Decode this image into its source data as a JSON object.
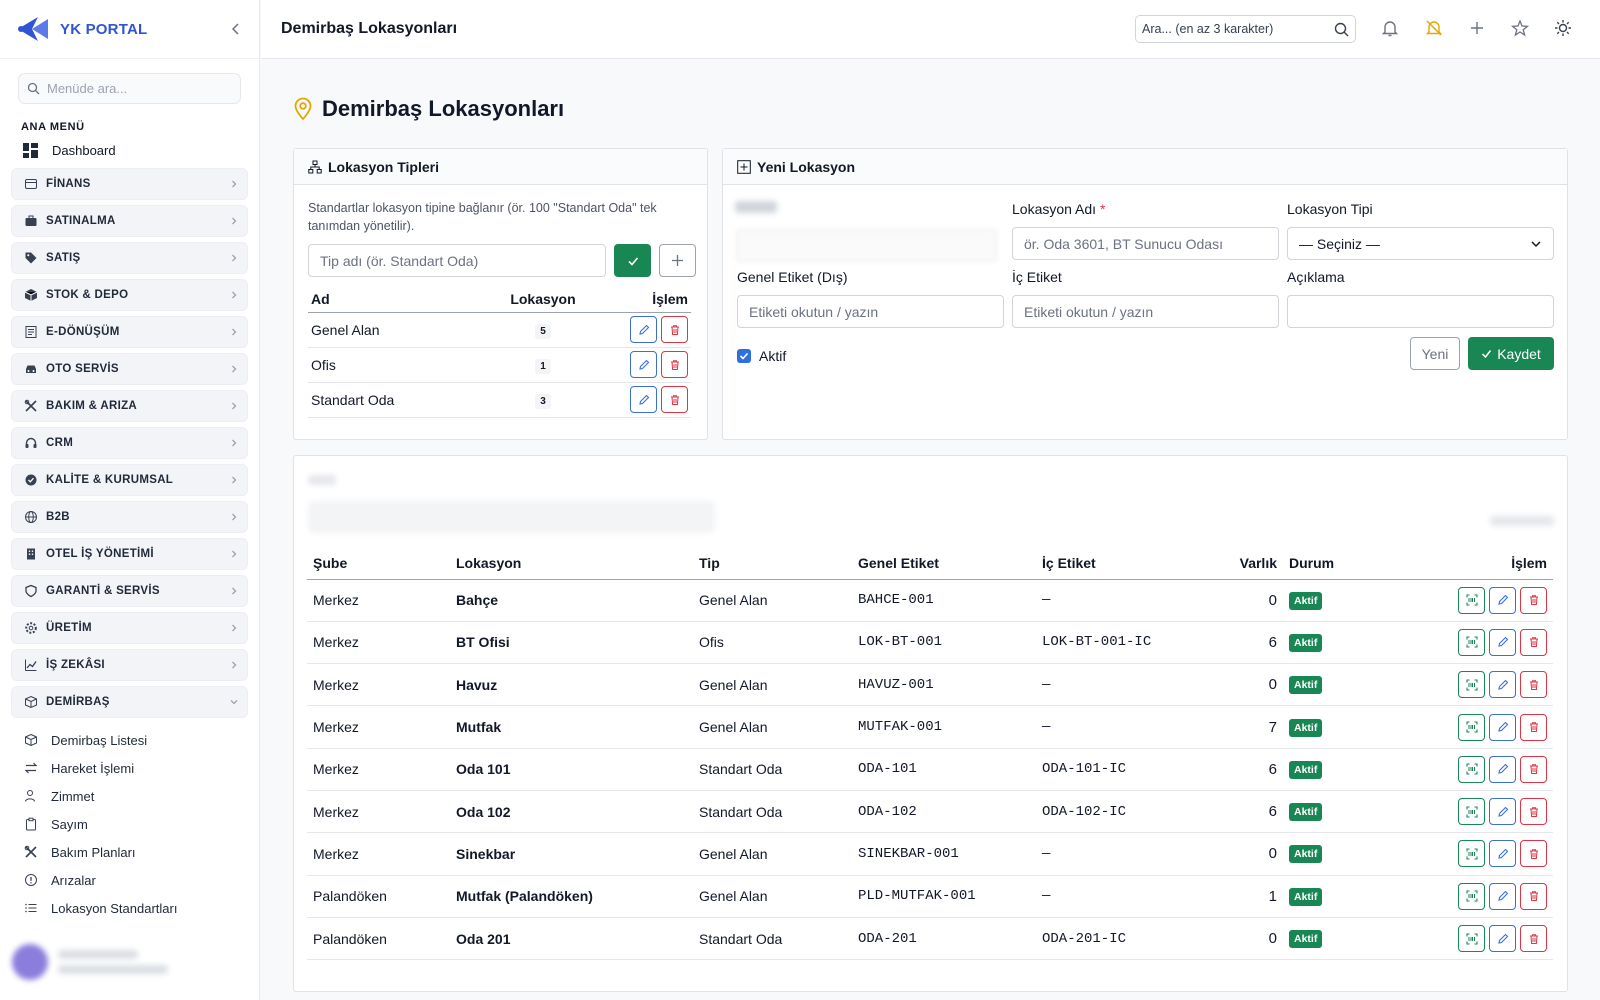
{
  "brand": {
    "name": "YK PORTAL"
  },
  "sidebar": {
    "search_placeholder": "Menüde ara...",
    "section_label": "ANA MENÜ",
    "dashboard": "Dashboard",
    "groups": [
      {
        "label": "FİNANS",
        "icon": "finance-icon"
      },
      {
        "label": "SATINALMA",
        "icon": "briefcase-icon"
      },
      {
        "label": "SATIŞ",
        "icon": "tag-icon"
      },
      {
        "label": "STOK & DEPO",
        "icon": "box-icon"
      },
      {
        "label": "E-DÖNÜŞÜM",
        "icon": "document-icon"
      },
      {
        "label": "OTO SERVİS",
        "icon": "car-icon"
      },
      {
        "label": "BAKIM & ARIZA",
        "icon": "tools-icon"
      },
      {
        "label": "CRM",
        "icon": "headset-icon"
      },
      {
        "label": "KALİTE & KURUMSAL",
        "icon": "badge-icon"
      },
      {
        "label": "B2B",
        "icon": "globe-icon"
      },
      {
        "label": "OTEL İŞ YÖNETİMİ",
        "icon": "building-icon"
      },
      {
        "label": "GARANTİ & SERVİS",
        "icon": "shield-icon"
      },
      {
        "label": "ÜRETİM",
        "icon": "gear-icon"
      },
      {
        "label": "İŞ ZEKÂSI",
        "icon": "chart-icon"
      },
      {
        "label": "DEMİRBAŞ",
        "icon": "cube-icon"
      }
    ],
    "sub_items": [
      {
        "label": "Demirbaş Listesi",
        "icon": "cube-icon"
      },
      {
        "label": "Hareket İşlemi",
        "icon": "arrows-icon"
      },
      {
        "label": "Zimmet",
        "icon": "user-icon"
      },
      {
        "label": "Sayım",
        "icon": "clipboard-icon"
      },
      {
        "label": "Bakım Planları",
        "icon": "tools-icon"
      },
      {
        "label": "Arızalar",
        "icon": "alert-icon"
      },
      {
        "label": "Lokasyon Standartları",
        "icon": "list-icon"
      }
    ]
  },
  "topbar": {
    "title": "Demirbaş Lokasyonları",
    "search_placeholder": "Ara... (en az 3 karakter)"
  },
  "page": {
    "title": "Demirbaş Lokasyonları"
  },
  "types_card": {
    "title": "Lokasyon Tipleri",
    "help": "Standartlar lokasyon tipine bağlanır (ör. 100 \"Standart Oda\" tek tanımdan yönetilir).",
    "input_placeholder": "Tip adı (ör. Standart Oda)",
    "columns": [
      "Ad",
      "Lokasyon",
      "İşlem"
    ],
    "rows": [
      {
        "name": "Genel Alan",
        "count": "5"
      },
      {
        "name": "Ofis",
        "count": "1"
      },
      {
        "name": "Standart Oda",
        "count": "3"
      }
    ]
  },
  "new_card": {
    "title": "Yeni Lokasyon",
    "name_label": "Lokasyon Adı",
    "name_placeholder": "ör. Oda 3601, BT Sunucu Odası",
    "type_label": "Lokasyon Tipi",
    "type_value": "— Seçiniz —",
    "ext_label": "Genel Etiket (Dış)",
    "ext_placeholder": "Etiketi okutun / yazın",
    "int_label": "İç Etiket",
    "int_placeholder": "Etiketi okutun / yazın",
    "desc_label": "Açıklama",
    "desc_value": "",
    "active_label": "Aktif",
    "active_checked": true,
    "new_button": "Yeni",
    "save_button": "Kaydet"
  },
  "locations": {
    "columns": [
      "Şube",
      "Lokasyon",
      "Tip",
      "Genel Etiket",
      "İç Etiket",
      "Varlık",
      "Durum",
      "İşlem"
    ],
    "rows": [
      {
        "branch": "Merkez",
        "name": "Bahçe",
        "type": "Genel Alan",
        "ext": "BAHCE-001",
        "int": "—",
        "assets": "0",
        "status": "Aktif"
      },
      {
        "branch": "Merkez",
        "name": "BT Ofisi",
        "type": "Ofis",
        "ext": "LOK-BT-001",
        "int": "LOK-BT-001-IC",
        "assets": "6",
        "status": "Aktif"
      },
      {
        "branch": "Merkez",
        "name": "Havuz",
        "type": "Genel Alan",
        "ext": "HAVUZ-001",
        "int": "—",
        "assets": "0",
        "status": "Aktif"
      },
      {
        "branch": "Merkez",
        "name": "Mutfak",
        "type": "Genel Alan",
        "ext": "MUTFAK-001",
        "int": "—",
        "assets": "7",
        "status": "Aktif"
      },
      {
        "branch": "Merkez",
        "name": "Oda 101",
        "type": "Standart Oda",
        "ext": "ODA-101",
        "int": "ODA-101-IC",
        "assets": "6",
        "status": "Aktif"
      },
      {
        "branch": "Merkez",
        "name": "Oda 102",
        "type": "Standart Oda",
        "ext": "ODA-102",
        "int": "ODA-102-IC",
        "assets": "6",
        "status": "Aktif"
      },
      {
        "branch": "Merkez",
        "name": "Sinekbar",
        "type": "Genel Alan",
        "ext": "SINEKBAR-001",
        "int": "—",
        "assets": "0",
        "status": "Aktif"
      },
      {
        "branch": "Palandöken",
        "name": "Mutfak (Palandöken)",
        "type": "Genel Alan",
        "ext": "PLD-MUTFAK-001",
        "int": "—",
        "assets": "1",
        "status": "Aktif"
      },
      {
        "branch": "Palandöken",
        "name": "Oda 201",
        "type": "Standart Oda",
        "ext": "ODA-201",
        "int": "ODA-201-IC",
        "assets": "0",
        "status": "Aktif"
      }
    ]
  },
  "colors": {
    "brand": "#2f55d4",
    "success": "#198754",
    "danger": "#dc3545",
    "primary": "#3b6fd6",
    "warning": "#e0a800"
  }
}
